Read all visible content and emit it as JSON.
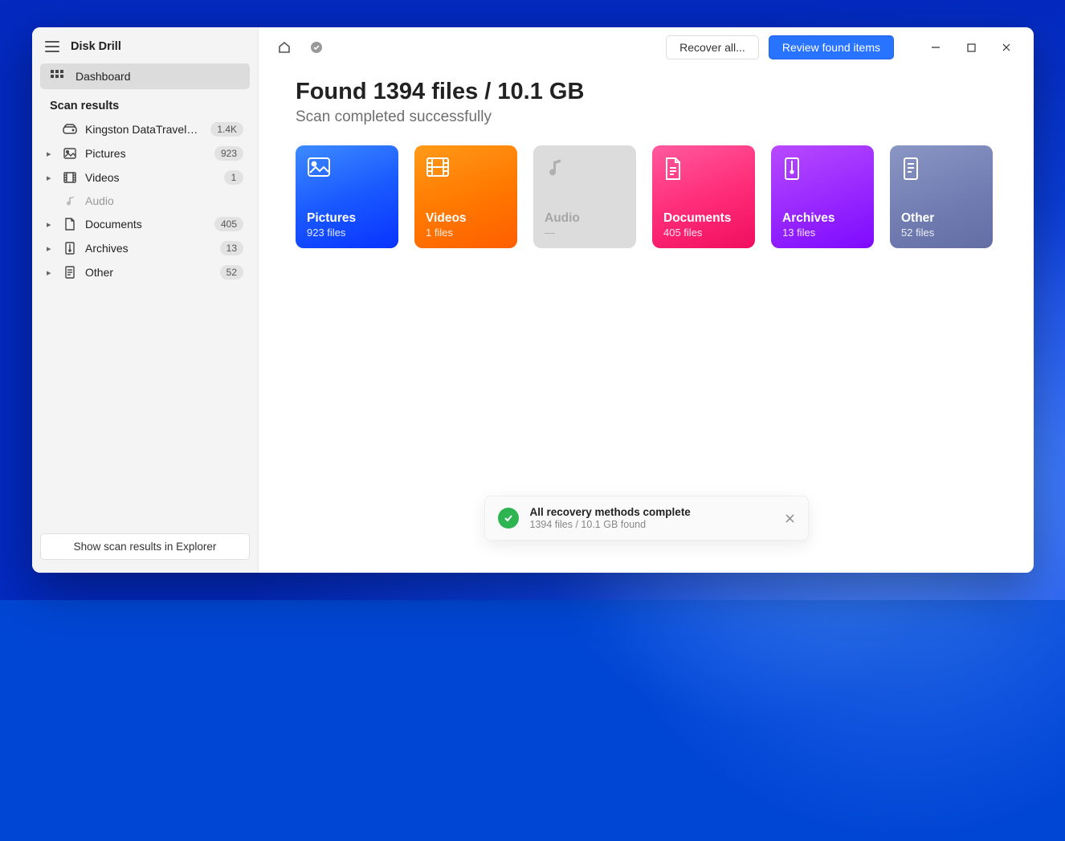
{
  "app": {
    "title": "Disk Drill"
  },
  "sidebar": {
    "dashboard_label": "Dashboard",
    "section_title": "Scan results",
    "drive": {
      "label": "Kingston DataTraveler 3…",
      "badge": "1.4K"
    },
    "items": [
      {
        "label": "Pictures",
        "badge": "923"
      },
      {
        "label": "Videos",
        "badge": "1"
      },
      {
        "label": "Audio",
        "badge": ""
      },
      {
        "label": "Documents",
        "badge": "405"
      },
      {
        "label": "Archives",
        "badge": "13"
      },
      {
        "label": "Other",
        "badge": "52"
      }
    ],
    "explorer_button": "Show scan results in Explorer"
  },
  "toolbar": {
    "recover_all": "Recover all...",
    "review_items": "Review found items"
  },
  "results": {
    "heading": "Found 1394 files / 10.1 GB",
    "subheading": "Scan completed successfully"
  },
  "cards": {
    "pictures": {
      "title": "Pictures",
      "sub": "923 files"
    },
    "videos": {
      "title": "Videos",
      "sub": "1 files"
    },
    "audio": {
      "title": "Audio",
      "sub": "—"
    },
    "documents": {
      "title": "Documents",
      "sub": "405 files"
    },
    "archives": {
      "title": "Archives",
      "sub": "13 files"
    },
    "other": {
      "title": "Other",
      "sub": "52 files"
    }
  },
  "toast": {
    "title": "All recovery methods complete",
    "sub": "1394 files / 10.1 GB found"
  }
}
